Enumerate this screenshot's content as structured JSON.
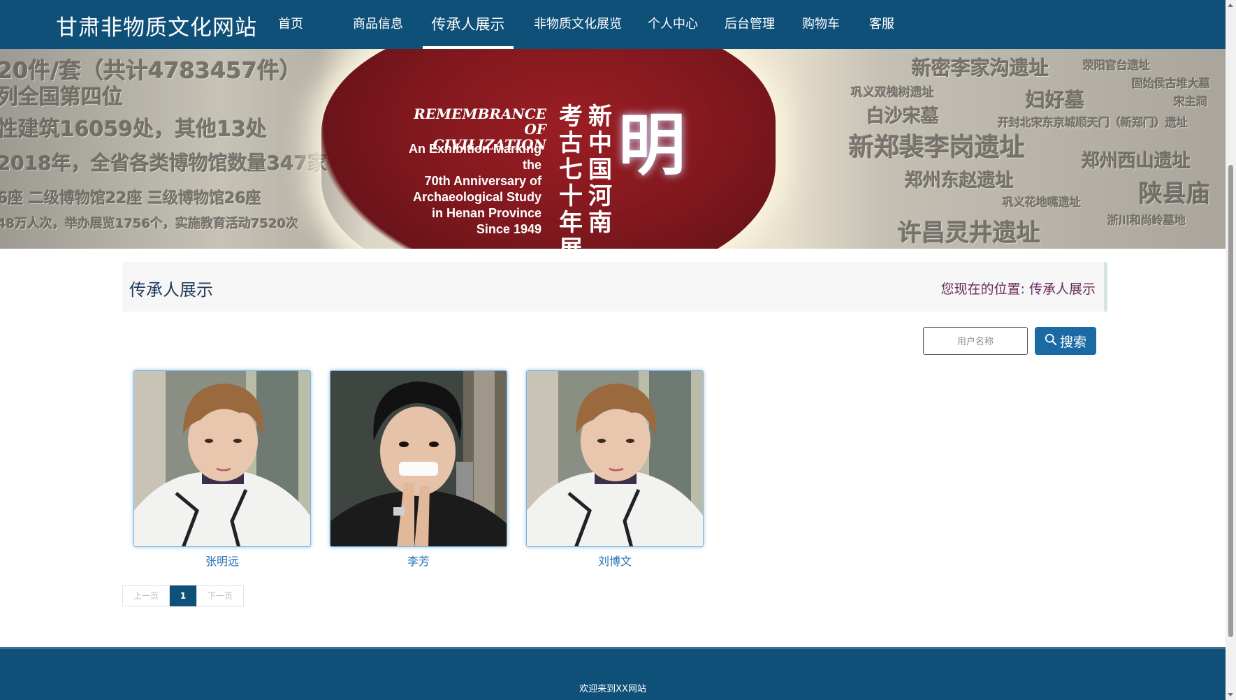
{
  "header": {
    "site_title": "甘肃非物质文化网站",
    "nav": [
      {
        "label": "首页"
      },
      {
        "label": "商品信息"
      },
      {
        "label": "传承人展示"
      },
      {
        "label": "非物质文化展览"
      },
      {
        "label": "个人中心"
      },
      {
        "label": "后台管理"
      },
      {
        "label": "购物车"
      },
      {
        "label": "客服"
      }
    ],
    "active_nav": "传承人展示"
  },
  "banner": {
    "en_title_1": "REMEMBRANCE",
    "en_title_2": "OF CIVILIZATION",
    "en_sub_1": "An Exhibition Marking the",
    "en_sub_2": "70th Anniversary of",
    "en_sub_3": "Archaeological Study",
    "en_sub_4": "in Henan Province",
    "en_sub_5": "Since 1949",
    "cn_col_1": "新中国河南",
    "cn_col_2": "考古七十年展",
    "big_char": "明",
    "wall_left": [
      "20件/套（共计4783457件）",
      "列全国第四位",
      "性建筑16059处，其他13处",
      "2018年，全省各类博物馆数量347家",
      "6座 二级博物馆22座 三级博物馆26座",
      "48万人次，举办展览1756个，实施教育活动7520次"
    ],
    "wall_right": [
      "新密李家沟遗址",
      "巩义双槐树遗址",
      "白沙宋墓",
      "新郑裴李岗遗址",
      "郑州东赵遗址",
      "巩义花地嘴遗址",
      "许昌灵井遗址",
      "荥阳官台遗址",
      "固始侯古堆大墓",
      "妇好墓",
      "宋主涧",
      "开封北宋东京城顺天门（新郑门）遗址",
      "郑州西山遗址",
      "陕县庙",
      "浙川和尚岭墓地"
    ],
    "slide_count": 3,
    "active_slide": 1
  },
  "titlebar": {
    "heading": "传承人展示",
    "breadcrumb_prefix": "您现在的位置:",
    "breadcrumb_current": "传承人展示"
  },
  "search": {
    "placeholder": "用户名称",
    "value": "",
    "button_label": "搜索"
  },
  "inheritors": [
    {
      "name": "张明远",
      "photo": "young-man-white-jacket"
    },
    {
      "name": "李芳",
      "photo": "young-man-black-shirt"
    },
    {
      "name": "刘博文",
      "photo": "young-man-white-jacket"
    }
  ],
  "pagination": {
    "prev_label": "上一页",
    "current_page": "1",
    "next_label": "下一页"
  },
  "footer": {
    "text": "欢迎来到XX网站"
  },
  "colors": {
    "primary": "#0f5079",
    "search_button": "#1a6aa3",
    "link": "#2a74b8",
    "breadcrumb": "#6b2a60"
  }
}
